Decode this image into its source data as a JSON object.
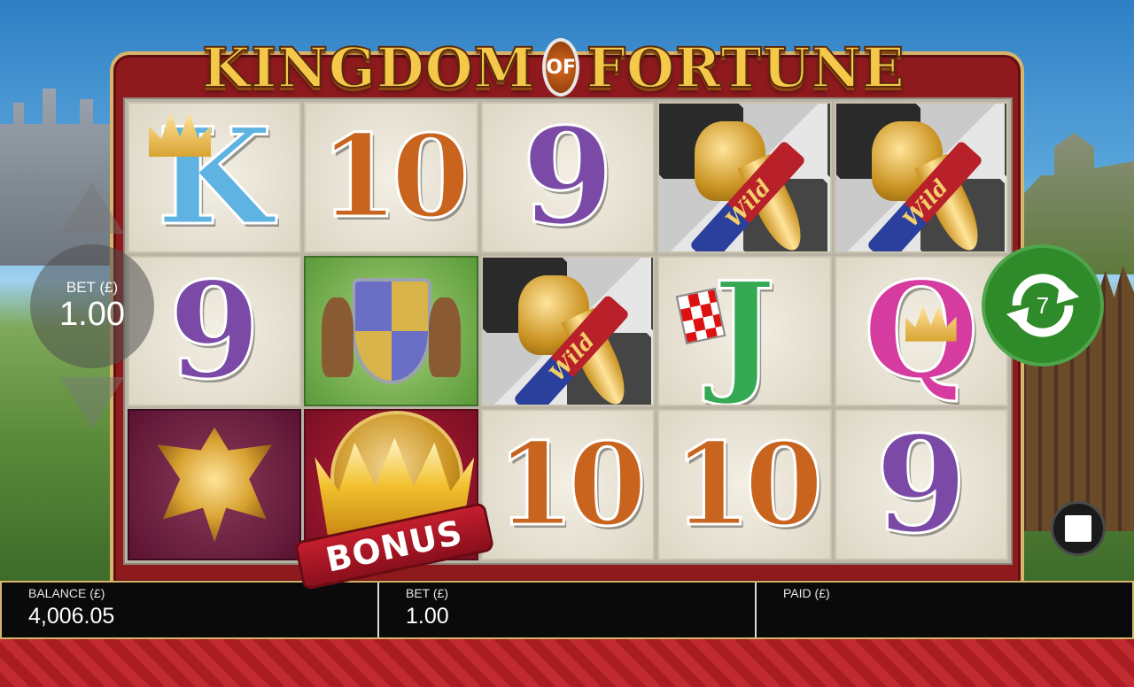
{
  "game": {
    "title_word_1": "KINGDOM",
    "title_of": "OF",
    "title_word_2": "FORTUNE"
  },
  "reels": {
    "symbols": [
      [
        "K",
        "10",
        "9",
        "Wild",
        "Wild"
      ],
      [
        "9",
        "crest",
        "Wild",
        "J",
        "Q"
      ],
      [
        "dragon",
        "BONUS",
        "10",
        "10",
        "9"
      ]
    ],
    "wild_label": "Wild",
    "bonus_label": "BONUS"
  },
  "bet_control": {
    "label": "BET (£)",
    "value": "1.00"
  },
  "autoplay": {
    "count": "7"
  },
  "bottom_bar": {
    "balance_label": "BALANCE (£)",
    "balance_value": "4,006.05",
    "bet_label": "BET (£)",
    "bet_value": "1.00",
    "paid_label": "PAID (£)",
    "paid_value": ""
  },
  "colors": {
    "frame": "#8f1a1e",
    "gold_trim": "#d8b46a",
    "autoplay_green": "#2f8a2a"
  },
  "icons": {
    "autoplay": "refresh-icon",
    "stop": "stop-icon",
    "bet_up": "triangle-up-icon",
    "bet_down": "triangle-down-icon"
  }
}
